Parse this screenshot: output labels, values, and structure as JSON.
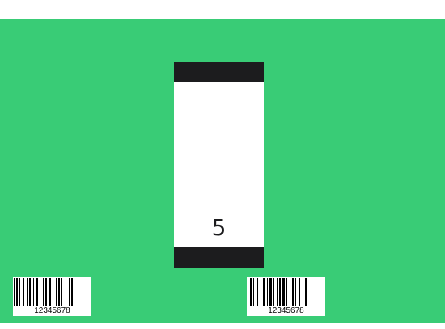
{
  "colors": {
    "background": "#39cc76",
    "tube_body": "#ffffff",
    "tube_cap": "#1c1c1e"
  },
  "tube": {
    "number": "5"
  },
  "barcodes": [
    {
      "text": "12345678"
    },
    {
      "text": "12345678"
    }
  ]
}
